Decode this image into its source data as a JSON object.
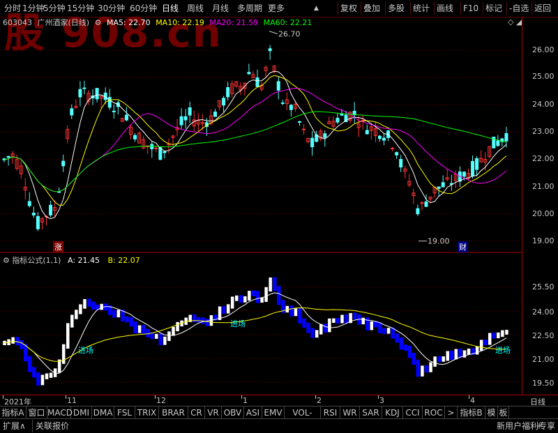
{
  "toolbar": {
    "left_items": [
      "分时",
      "1分钟",
      "5分钟",
      "15分钟",
      "30分钟",
      "60分钟",
      "日线",
      "周线",
      "月线",
      "多周期",
      "更多"
    ],
    "more_arrow": "▲",
    "right_items": [
      "复权",
      "叠加",
      "多股",
      "统计",
      "画线",
      "F10",
      "标记",
      "-自选",
      "返回"
    ]
  },
  "watermark": "股 908.cn",
  "main_chart": {
    "code": "603043",
    "name": "广州酒家(日线)",
    "ma_labels": [
      {
        "text": "MA5: 22.70",
        "color": "#ffffff"
      },
      {
        "text": "MA10: 22.19",
        "color": "#ffff00"
      },
      {
        "text": "MA20: 21.59",
        "color": "#ff00ff"
      },
      {
        "text": "MA60: 22.21",
        "color": "#00ff00"
      }
    ],
    "price_ticks": [
      "26.00",
      "25.00",
      "24.00",
      "23.00",
      "22.00",
      "21.00",
      "20.00",
      "19.00"
    ],
    "high_label": "26.70",
    "low_label": "19.00",
    "marker_zhang": "涨",
    "marker_cai": "财",
    "colors": {
      "up": "#ff3232",
      "down": "#54ffff",
      "ma5": "#ffffff",
      "ma10": "#ffff00",
      "ma20": "#ff00ff",
      "ma60": "#00ff00"
    }
  },
  "sub_chart": {
    "title": "指标公式(1,1)",
    "a_label": "A: 21.45",
    "b_label": "B: 22.07",
    "ticks": [
      "25.50",
      "24.00",
      "22.50",
      "21.00",
      "19.50"
    ],
    "annotations": [
      "进场",
      "进场",
      "进场"
    ],
    "colors": {
      "up": "#ffffff",
      "down": "#0000ff",
      "a_line": "#ffffff",
      "b_line": "#ffff00",
      "annot": "#00ffff"
    }
  },
  "date_axis": {
    "labels": [
      "2021年",
      "11",
      "12",
      "1",
      "2",
      "3",
      "4"
    ],
    "period": "日线"
  },
  "indicator_tabs": [
    "指标A",
    "窗口",
    "MACD",
    "DMI",
    "DMA",
    "FSL",
    "TRIX",
    "BRAR",
    "CR",
    "VR",
    "OBV",
    "ASI",
    "EMV",
    "VOL-TDX",
    "RSI",
    "WR",
    "SAR",
    "KDJ",
    "CCI",
    "ROC",
    ">",
    "指标B",
    "模",
    "板"
  ],
  "status_bar": {
    "expand": "扩展∧",
    "related": "关联报价",
    "promo": "新用户福利专享",
    "plus": "+",
    "minus": "-"
  }
}
